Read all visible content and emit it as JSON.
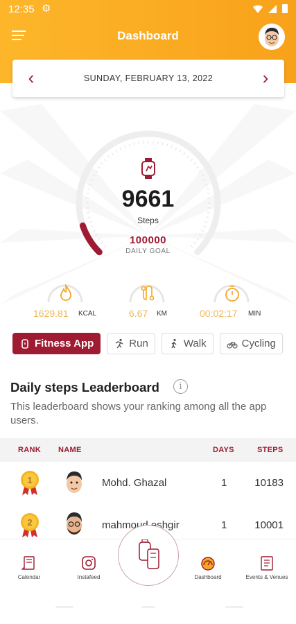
{
  "status_bar": {
    "time": "12:35",
    "settings_icon": "gear-icon",
    "icons": [
      "wifi-icon",
      "signal-icon",
      "battery-icon"
    ]
  },
  "header": {
    "title": "Dashboard",
    "menu_icon": "hamburger-menu-icon",
    "avatar_icon": "user-avatar-icon"
  },
  "date_nav": {
    "date": "SUNDAY, FEBRUARY 13, 2022",
    "prev_icon": "chevron-left-icon",
    "next_icon": "chevron-right-icon"
  },
  "steps": {
    "value": "9661",
    "label": "Steps",
    "goal": "100000",
    "goal_label": "DAILY GOAL",
    "progress_fraction": 0.0966
  },
  "metrics": [
    {
      "icon": "flame-icon",
      "value": "1629.81",
      "unit": "KCAL"
    },
    {
      "icon": "route-icon",
      "value": "6.67",
      "unit": "KM"
    },
    {
      "icon": "stopwatch-icon",
      "value": "00:02:17",
      "unit": "MIN"
    }
  ],
  "filters": [
    {
      "label": "Fitness App",
      "icon": "watch-icon",
      "active": true
    },
    {
      "label": "Run",
      "icon": "run-icon",
      "active": false
    },
    {
      "label": "Walk",
      "icon": "walk-icon",
      "active": false
    },
    {
      "label": "Cycling",
      "icon": "bike-icon",
      "active": false
    }
  ],
  "leaderboard": {
    "title": "Daily steps Leaderboard",
    "description": "This leaderboard shows your ranking among all the app users.",
    "columns": {
      "rank": "RANK",
      "name": "NAME",
      "days": "DAYS",
      "steps": "STEPS"
    },
    "rows": [
      {
        "rank": "1",
        "name": "Mohd. Ghazal",
        "days": "1",
        "steps": "10183"
      },
      {
        "rank": "2",
        "name": "mahmoud.eshgir",
        "days": "1",
        "steps": "10001"
      }
    ]
  },
  "bottom_nav": [
    {
      "label": "Calendar",
      "icon": "calendar-icon"
    },
    {
      "label": "Instafeed",
      "icon": "instagram-icon"
    },
    {
      "label": "",
      "icon": "fitness-tracker-icon"
    },
    {
      "label": "Dashboard",
      "icon": "dashboard-gauge-icon"
    },
    {
      "label": "Events & Venues",
      "icon": "events-list-icon"
    }
  ],
  "colors": {
    "header": "#fdb62a",
    "accent": "#9e1b32",
    "metric_value": "#f0b95a",
    "gauge_track": "#eeeeee"
  }
}
